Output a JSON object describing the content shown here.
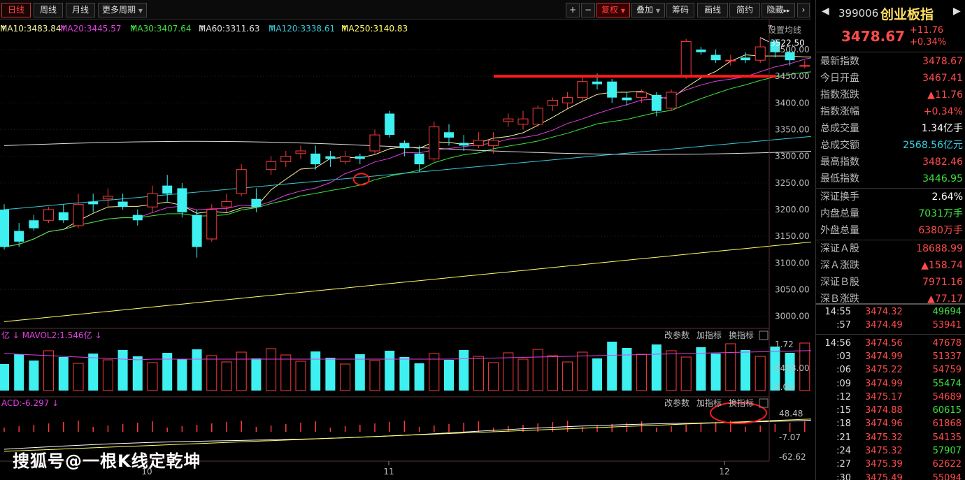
{
  "toolbar": {
    "periods": [
      "日线",
      "周线",
      "月线",
      "更多周期"
    ],
    "active_period": "日线",
    "zoom_in": "+",
    "zoom_out": "−",
    "tools": [
      "复权",
      "叠加",
      "筹码",
      "画线",
      "简约",
      "隐藏"
    ],
    "more": "▸▸"
  },
  "ma_legend": [
    {
      "text": "MA10:3483.84",
      "color": "#f5f5a0"
    },
    {
      "text": "MA20:3445.57",
      "color": "#e040e0"
    },
    {
      "text": "MA30:3407.64",
      "color": "#3ee33e"
    },
    {
      "text": "MA60:3311.63",
      "color": "#dddddd"
    },
    {
      "text": "MA120:3338.61",
      "color": "#38c8d8"
    },
    {
      "text": "MA250:3140.83",
      "color": "#ffff66"
    }
  ],
  "ma_setting": "设置均线",
  "price_axis": [
    "3500.00",
    "3450.00",
    "3400.00",
    "3350.00",
    "3300.00",
    "3250.00",
    "3200.00",
    "3150.00",
    "3100.00",
    "3050.00",
    "3000.00"
  ],
  "high_label": "3522.50",
  "volume": {
    "legend": "亿 ↓  MAVOL2:1.546亿 ↓",
    "buttons": [
      "改参数",
      "加指标",
      "换指标"
    ],
    "axis": [
      "1.72",
      "8468.00",
      "0.00"
    ]
  },
  "macd": {
    "legend": "ACD:-6.297 ↓",
    "buttons": [
      "改参数",
      "加指标",
      "换指标"
    ],
    "axis": [
      "48.48",
      "-7.07",
      "-62.62"
    ]
  },
  "months": [
    "10",
    "11",
    "12"
  ],
  "quote": {
    "code": "399006",
    "name": "创业板指",
    "price": "3478.67",
    "change": "+11.76",
    "change_pct": "+0.34%"
  },
  "stats": [
    {
      "k": "最新指数",
      "v": "3478.67",
      "c": "#ff4b4b"
    },
    {
      "k": "今日开盘",
      "v": "3467.41",
      "c": "#ff4b4b"
    },
    {
      "k": "指数涨跌",
      "v": "▲11.76",
      "c": "#ff4b4b"
    },
    {
      "k": "指数涨幅",
      "v": "+0.34%",
      "c": "#ff4b4b"
    },
    {
      "k": "总成交量",
      "v": "1.34亿手",
      "c": "#ffffff"
    },
    {
      "k": "总成交额",
      "v": "2568.56亿元",
      "c": "#38d0e0"
    },
    {
      "k": "最高指数",
      "v": "3482.46",
      "c": "#ff4b4b"
    },
    {
      "k": "最低指数",
      "v": "3446.95",
      "c": "#3ee33e"
    },
    {
      "k": "深证换手",
      "v": "2.64%",
      "c": "#ffffff"
    },
    {
      "k": "内盘总量",
      "v": "7031万手",
      "c": "#3ee33e"
    },
    {
      "k": "外盘总量",
      "v": "6380万手",
      "c": "#ff4b4b"
    },
    {
      "k": "深证Ａ股",
      "v": "18688.99",
      "c": "#ff4b4b"
    },
    {
      "k": "深Ａ涨跌",
      "v": "▲158.74",
      "c": "#ff4b4b"
    },
    {
      "k": "深证Ｂ股",
      "v": "7971.16",
      "c": "#ff4b4b"
    },
    {
      "k": "深Ｂ涨跌",
      "v": "▲77.17",
      "c": "#ff4b4b"
    }
  ],
  "ticks": [
    {
      "t": "14:55",
      "p": "3474.32",
      "v": "49694",
      "c": "#3ee33e"
    },
    {
      "t": ":57",
      "p": "3474.49",
      "v": "53941",
      "c": "#ff4b4b"
    },
    {
      "t": "14:56",
      "p": "3474.56",
      "v": "47678",
      "c": "#ff4b4b"
    },
    {
      "t": ":03",
      "p": "3474.99",
      "v": "51337",
      "c": "#ff4b4b"
    },
    {
      "t": ":06",
      "p": "3475.22",
      "v": "54759",
      "c": "#ff4b4b"
    },
    {
      "t": ":09",
      "p": "3474.99",
      "v": "55474",
      "c": "#3ee33e"
    },
    {
      "t": ":12",
      "p": "3475.17",
      "v": "54689",
      "c": "#ff4b4b"
    },
    {
      "t": ":15",
      "p": "3474.88",
      "v": "60615",
      "c": "#3ee33e"
    },
    {
      "t": ":18",
      "p": "3474.96",
      "v": "61868",
      "c": "#ff4b4b"
    },
    {
      "t": ":21",
      "p": "3475.32",
      "v": "54135",
      "c": "#ff4b4b"
    },
    {
      "t": ":24",
      "p": "3475.32",
      "v": "57907",
      "c": "#3ee33e"
    },
    {
      "t": ":27",
      "p": "3475.39",
      "v": "62622",
      "c": "#ff4b4b"
    },
    {
      "t": ":30",
      "p": "3475.49",
      "v": "55094",
      "c": "#ff4b4b"
    }
  ],
  "watermark": "搜狐号@一根K线定乾坤",
  "chart_data": {
    "type": "candlestick",
    "ylim": [
      2980,
      3530
    ],
    "support_level": 3450,
    "candles": [
      [
        3200,
        3130,
        3210,
        3125
      ],
      [
        3160,
        3140,
        3175,
        3130
      ],
      [
        3180,
        3165,
        3190,
        3160
      ],
      [
        3180,
        3200,
        3205,
        3175
      ],
      [
        3195,
        3180,
        3210,
        3175
      ],
      [
        3170,
        3210,
        3230,
        3165
      ],
      [
        3215,
        3210,
        3230,
        3195
      ],
      [
        3220,
        3225,
        3240,
        3205
      ],
      [
        3215,
        3205,
        3230,
        3200
      ],
      [
        3190,
        3180,
        3200,
        3170
      ],
      [
        3205,
        3230,
        3245,
        3195
      ],
      [
        3245,
        3230,
        3265,
        3215
      ],
      [
        3240,
        3195,
        3250,
        3185
      ],
      [
        3190,
        3130,
        3200,
        3110
      ],
      [
        3145,
        3200,
        3210,
        3140
      ],
      [
        3205,
        3215,
        3230,
        3195
      ],
      [
        3230,
        3275,
        3285,
        3225
      ],
      [
        3220,
        3205,
        3240,
        3195
      ],
      [
        3275,
        3290,
        3300,
        3265
      ],
      [
        3290,
        3300,
        3310,
        3280
      ],
      [
        3305,
        3310,
        3320,
        3295
      ],
      [
        3305,
        3285,
        3320,
        3275
      ],
      [
        3300,
        3295,
        3310,
        3280
      ],
      [
        3290,
        3300,
        3310,
        3285
      ],
      [
        3300,
        3295,
        3305,
        3285
      ],
      [
        3310,
        3340,
        3350,
        3305
      ],
      [
        3380,
        3340,
        3385,
        3335
      ],
      [
        3325,
        3315,
        3330,
        3300
      ],
      [
        3305,
        3285,
        3320,
        3270
      ],
      [
        3295,
        3355,
        3365,
        3290
      ],
      [
        3345,
        3335,
        3360,
        3320
      ],
      [
        3325,
        3320,
        3340,
        3310
      ],
      [
        3320,
        3330,
        3345,
        3315
      ],
      [
        3320,
        3330,
        3345,
        3305
      ],
      [
        3365,
        3370,
        3380,
        3355
      ],
      [
        3360,
        3370,
        3385,
        3350
      ],
      [
        3360,
        3390,
        3395,
        3355
      ],
      [
        3395,
        3405,
        3410,
        3385
      ],
      [
        3400,
        3410,
        3420,
        3390
      ],
      [
        3410,
        3440,
        3450,
        3405
      ],
      [
        3440,
        3435,
        3455,
        3425
      ],
      [
        3440,
        3410,
        3445,
        3400
      ],
      [
        3410,
        3405,
        3420,
        3395
      ],
      [
        3410,
        3420,
        3425,
        3400
      ],
      [
        3415,
        3385,
        3420,
        3375
      ],
      [
        3390,
        3420,
        3425,
        3385
      ],
      [
        3450,
        3515,
        3520,
        3445
      ],
      [
        3500,
        3495,
        3505,
        3490
      ],
      [
        3490,
        3480,
        3500,
        3475
      ],
      [
        3480,
        3480,
        3490,
        3470
      ],
      [
        3485,
        3480,
        3495,
        3475
      ],
      [
        3480,
        3505,
        3522.5,
        3475
      ],
      [
        3515,
        3495,
        3520,
        3485
      ],
      [
        3495,
        3480,
        3500,
        3470
      ],
      [
        3470,
        3470,
        3480,
        3465
      ],
      [
        3467.41,
        3478.67,
        3482.46,
        3446.95
      ]
    ]
  }
}
